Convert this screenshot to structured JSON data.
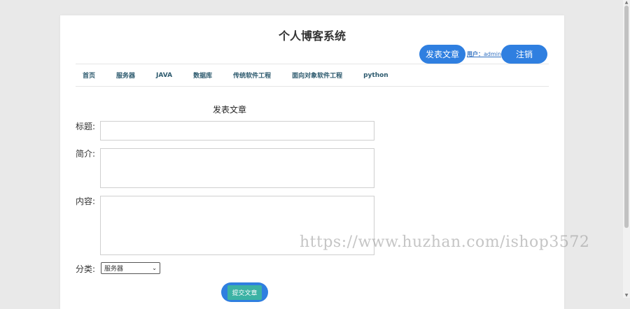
{
  "site": {
    "title": "个人博客系统"
  },
  "header": {
    "publish_button": "发表文章",
    "user_prefix": "用户：",
    "username": "admin",
    "logout_button": "注销"
  },
  "nav": {
    "items": [
      "首页",
      "服务器",
      "JAVA",
      "数据库",
      "传统软件工程",
      "面向对象软件工程",
      "python"
    ]
  },
  "form": {
    "heading": "发表文章",
    "title_label": "标题:",
    "title_value": "",
    "summary_label": "简介:",
    "summary_value": "",
    "content_label": "内容:",
    "content_value": "",
    "category_label": "分类:",
    "category_selected": "服务器",
    "submit_label": "提交文章"
  },
  "watermark": "https://www.huzhan.com/ishop3572",
  "colors": {
    "accent": "#2f7fe0",
    "submit_inner": "#3bb2a4",
    "nav_text": "#2d5a6e"
  }
}
